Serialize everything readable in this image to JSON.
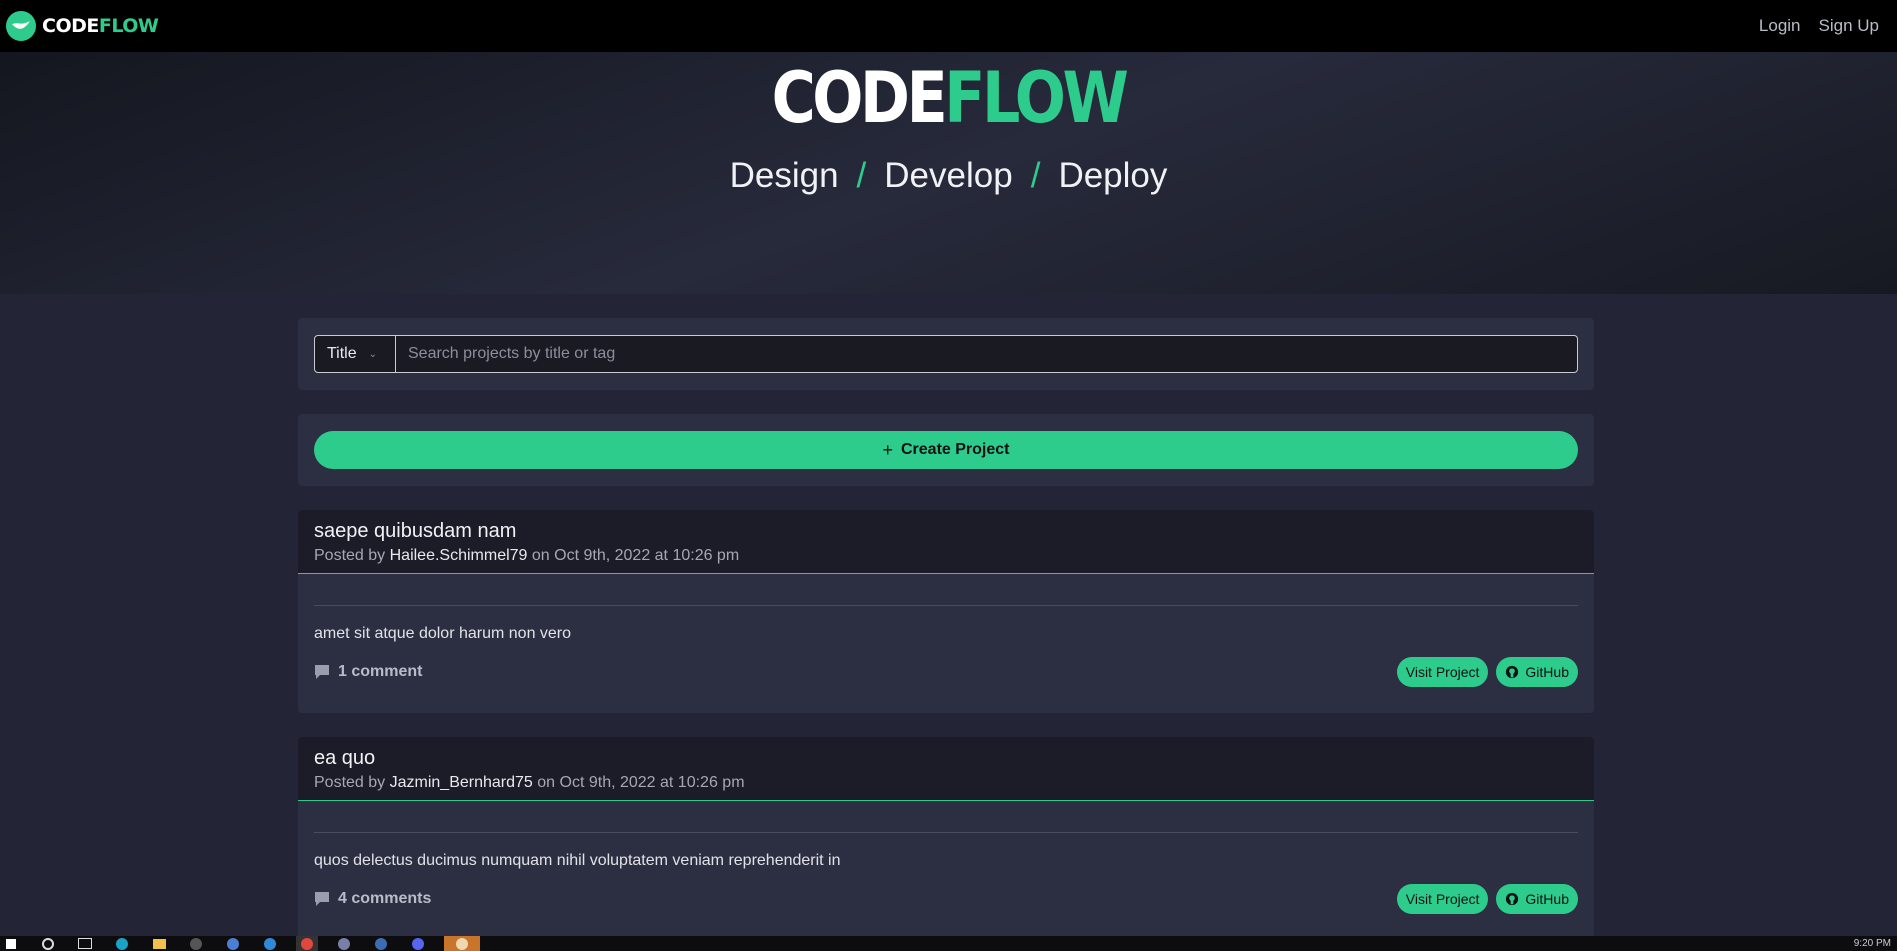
{
  "navbar": {
    "brand_code": "CODE",
    "brand_flow": "FLOW",
    "login": "Login",
    "signup": "Sign Up"
  },
  "hero": {
    "title_code": "CODE",
    "title_flow": "FLOW",
    "tagline": [
      "Design",
      "Develop",
      "Deploy"
    ],
    "separator": "/"
  },
  "search": {
    "filter_value": "Title",
    "placeholder": "Search projects by title or tag"
  },
  "create": {
    "label": "Create Project"
  },
  "posts": [
    {
      "title": "saepe quibusdam nam",
      "posted_by": "Posted by",
      "author": "Hailee.Schimmel79",
      "date": "on Oct 9th, 2022 at 10:26 pm",
      "description": "amet sit atque dolor harum non vero",
      "comments": "1 comment",
      "visit": "Visit Project",
      "github": "GitHub"
    },
    {
      "title": "ea quo",
      "posted_by": "Posted by",
      "author": "Jazmin_Bernhard75",
      "date": "on Oct 9th, 2022 at 10:26 pm",
      "description": "quos delectus ducimus numquam nihil voluptatem veniam reprehenderit in",
      "comments": "4 comments",
      "visit": "Visit Project",
      "github": "GitHub"
    }
  ],
  "colors": {
    "accent": "#2ecc8c",
    "background": "#232536",
    "panel": "#2c2f42",
    "navbar": "#000000"
  },
  "taskbar": {
    "clock": "9:20 PM"
  }
}
